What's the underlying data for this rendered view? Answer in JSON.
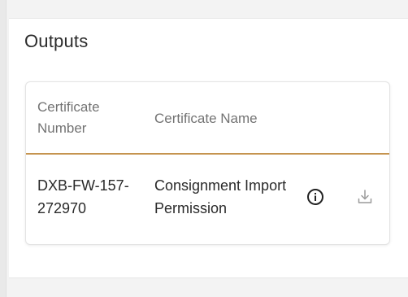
{
  "section": {
    "title": "Outputs"
  },
  "table": {
    "columns": {
      "number": "Certificate Number",
      "name": "Certificate Name"
    },
    "rows": [
      {
        "number": "DXB-FW-157-272970",
        "name": "Consignment Import Permission",
        "actions": [
          "info-icon",
          "download-icon"
        ]
      }
    ]
  },
  "colors": {
    "accent": "#c5944f",
    "header_text": "#737373",
    "body_text": "#2a2a2a"
  }
}
